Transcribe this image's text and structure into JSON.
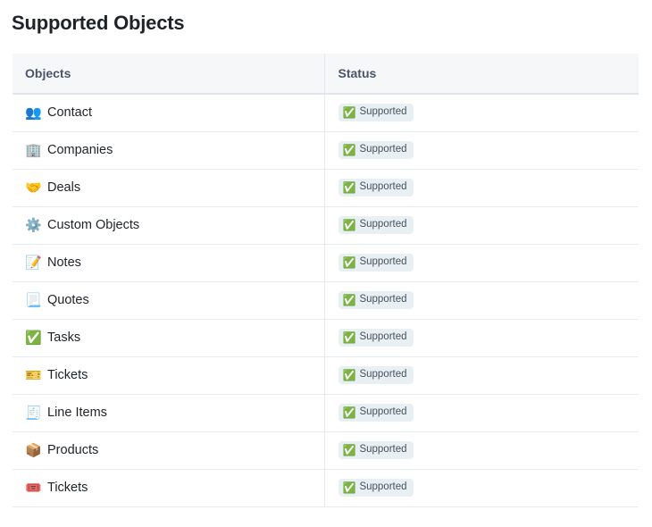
{
  "page": {
    "title": "Supported Objects"
  },
  "table": {
    "columns": [
      {
        "key": "objects",
        "label": "Objects"
      },
      {
        "key": "status",
        "label": "Status"
      }
    ],
    "rows": [
      {
        "icon": "👥",
        "icon_name": "busts-in-silhouette-icon",
        "label": "Contact",
        "status": "Supported",
        "status_icon": "✅",
        "status_icon_name": "check-mark-button-icon"
      },
      {
        "icon": "🏢",
        "icon_name": "office-building-icon",
        "label": "Companies",
        "status": "Supported",
        "status_icon": "✅",
        "status_icon_name": "check-mark-button-icon"
      },
      {
        "icon": "🤝",
        "icon_name": "handshake-icon",
        "label": "Deals",
        "status": "Supported",
        "status_icon": "✅",
        "status_icon_name": "check-mark-button-icon"
      },
      {
        "icon": "⚙️",
        "icon_name": "gear-icon",
        "label": "Custom Objects",
        "status": "Supported",
        "status_icon": "✅",
        "status_icon_name": "check-mark-button-icon"
      },
      {
        "icon": "📝",
        "icon_name": "memo-icon",
        "label": "Notes",
        "status": "Supported",
        "status_icon": "✅",
        "status_icon_name": "check-mark-button-icon"
      },
      {
        "icon": "📃",
        "icon_name": "page-with-curl-icon",
        "label": "Quotes",
        "status": "Supported",
        "status_icon": "✅",
        "status_icon_name": "check-mark-button-icon"
      },
      {
        "icon": "✅",
        "icon_name": "check-mark-button-icon",
        "label": "Tasks",
        "status": "Supported",
        "status_icon": "✅",
        "status_icon_name": "check-mark-button-icon"
      },
      {
        "icon": "🎫",
        "icon_name": "ticket-card-icon",
        "label": "Tickets",
        "status": "Supported",
        "status_icon": "✅",
        "status_icon_name": "check-mark-button-icon"
      },
      {
        "icon": "🧾",
        "icon_name": "receipt-icon",
        "label": "Line Items",
        "status": "Supported",
        "status_icon": "✅",
        "status_icon_name": "check-mark-button-icon"
      },
      {
        "icon": "📦",
        "icon_name": "package-icon",
        "label": "Products",
        "status": "Supported",
        "status_icon": "✅",
        "status_icon_name": "check-mark-button-icon"
      },
      {
        "icon": "🎟️",
        "icon_name": "admission-ticket-icon",
        "label": "Tickets",
        "status": "Supported",
        "status_icon": "✅",
        "status_icon_name": "check-mark-button-icon"
      }
    ]
  },
  "colors": {
    "header_background": "#f5f7f9",
    "header_text": "#4a5568",
    "row_border": "#e6ebf0",
    "badge_background": "#e8f0f4",
    "badge_text": "#46525f",
    "title_text": "#1f2328"
  }
}
